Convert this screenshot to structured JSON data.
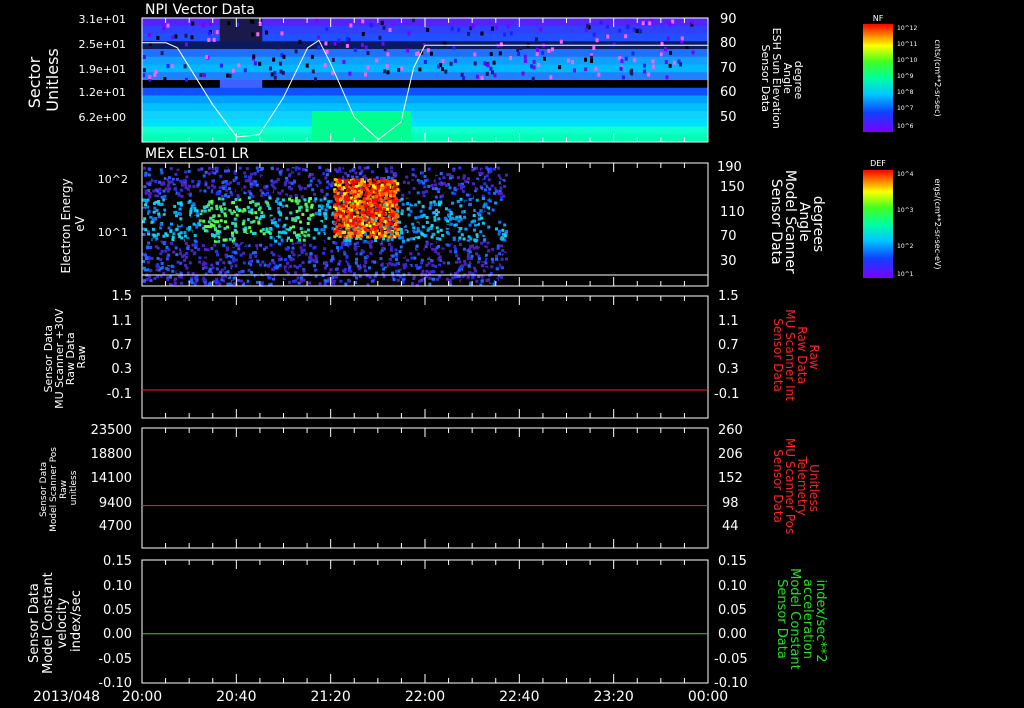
{
  "colors": {
    "background": "#000000",
    "foreground": "#ffffff",
    "red": "#ff2020",
    "green": "#20e020"
  },
  "time_axis": {
    "date_label": "2013/048",
    "ticks": [
      "20:00",
      "20:40",
      "21:20",
      "22:00",
      "22:40",
      "23:20",
      "00:00"
    ],
    "range_hours": [
      20,
      24
    ]
  },
  "chart_data": [
    {
      "type": "heatmap",
      "title": "NPI Vector Data",
      "ylabel": "Sector\nUnitless",
      "yticks": [
        "3.1e+01",
        "2.5e+01",
        "1.9e+01",
        "1.2e+01",
        "6.2e+00"
      ],
      "right_axis": {
        "label": [
          "Sensor Data",
          "ESH Sun Elevation",
          "Angle",
          "degree"
        ],
        "ticks": [
          90,
          80,
          70,
          60,
          50
        ],
        "range": [
          40,
          90
        ]
      },
      "colorbar": {
        "title": "NF",
        "units": "cnts/(cm**2-sr-sec)",
        "ticks": [
          "10^12",
          "10^11",
          "10^10",
          "10^9",
          "10^8",
          "10^7",
          "10^6"
        ]
      },
      "overlay_line": {
        "name": "ESH Sun Elevation Angle",
        "x_hours": [
          20.0,
          20.17,
          20.25,
          20.5,
          20.67,
          20.83,
          21.0,
          21.17,
          21.25,
          21.33,
          21.5,
          21.67,
          21.83,
          21.92,
          22.0,
          23.0,
          24.0
        ],
        "y": [
          80,
          80,
          78,
          55,
          42,
          43,
          58,
          78,
          81,
          72,
          50,
          41,
          48,
          70,
          79,
          79,
          79
        ]
      }
    },
    {
      "type": "heatmap",
      "title": "MEx ELS-01 LR",
      "ylabel": "Electron Energy\neV",
      "yticks": [
        "10^2",
        "10^1"
      ],
      "right_axis": {
        "label": [
          "Sensor Data",
          "Model Scanner",
          "Angle",
          "degrees"
        ],
        "ticks": [
          190,
          150,
          110,
          70,
          30
        ]
      },
      "colorbar": {
        "title": "DEF",
        "units": "ergs/(cm**2-sr-sec-eV)",
        "ticks": [
          "10^4",
          "10^3",
          "10^2",
          "10^1"
        ]
      },
      "data_end_hour": 22.58,
      "overlay_line": {
        "name": "Model Scanner Angle",
        "value": 0
      }
    },
    {
      "type": "line",
      "left_label": [
        "Sensor Data",
        "MU Scanner +30V",
        "Raw Data",
        "Raw"
      ],
      "right_label": [
        "Sensor Data",
        "MU Scanner Int",
        "Raw Data",
        "Raw"
      ],
      "left_ticks": [
        "1.5",
        "1.1",
        "0.7",
        "0.3",
        "-0.1"
      ],
      "right_ticks": [
        "1.5",
        "1.1",
        "0.7",
        "0.3",
        "-0.1"
      ],
      "ylim": [
        -0.5,
        1.5
      ],
      "series": [
        {
          "color": "#ff2020",
          "x_hours": [
            20,
            24
          ],
          "y": [
            -0.04,
            -0.04
          ]
        }
      ]
    },
    {
      "type": "line",
      "left_label": [
        "Sensor Data",
        "Model Scanner Pos",
        "Raw",
        "unitless"
      ],
      "right_label": [
        "Sensor Data",
        "MU Scanner Pos",
        "Telemetry",
        "Unitless"
      ],
      "left_ticks": [
        "23500",
        "18800",
        "14100",
        "9400",
        "4700"
      ],
      "right_ticks": [
        "260",
        "206",
        "152",
        "98",
        "44"
      ],
      "ylim": [
        0,
        23500
      ],
      "series": [
        {
          "color": "#ff2020",
          "x_hours": [
            20,
            24
          ],
          "y": [
            8300,
            8300
          ]
        }
      ]
    },
    {
      "type": "line",
      "left_label": [
        "Sensor Data",
        "Model Constant",
        "velocity",
        "index/sec"
      ],
      "right_label": [
        "Sensor Data",
        "Model Constant",
        "acceleration",
        "index/sec**2"
      ],
      "left_ticks": [
        "0.15",
        "0.10",
        "0.05",
        "0.00",
        "-0.05",
        "-0.10"
      ],
      "right_ticks": [
        "0.15",
        "0.10",
        "0.05",
        "0.00",
        "-0.05",
        "-0.10"
      ],
      "ylim": [
        -0.1,
        0.15
      ],
      "series": [
        {
          "color": "#20e020",
          "x_hours": [
            20,
            24
          ],
          "y": [
            0,
            0
          ]
        }
      ]
    }
  ]
}
